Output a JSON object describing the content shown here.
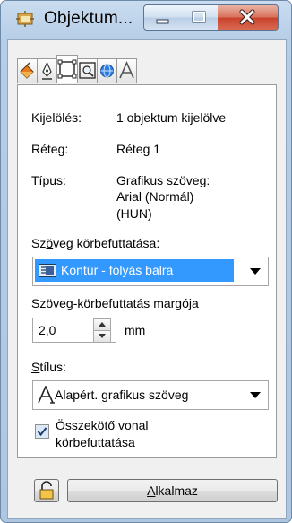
{
  "window": {
    "title": "Objektum...",
    "minimize_icon": "minimize-icon",
    "maximize_icon": "maximize-icon",
    "close_icon": "close-icon",
    "app_icon": "object-properties-icon"
  },
  "tabs": [
    {
      "name": "fill-tab",
      "icon": "fill-bucket-icon"
    },
    {
      "name": "outline-tab",
      "icon": "pen-nib-icon"
    },
    {
      "name": "general-tab",
      "icon": "selection-frame-icon",
      "active": true
    },
    {
      "name": "detail-tab",
      "icon": "zoom-frame-icon"
    },
    {
      "name": "internet-tab",
      "icon": "globe-icon"
    },
    {
      "name": "text-tab",
      "icon": "text-a-icon"
    }
  ],
  "info": {
    "selection_label": "Kijelölés:",
    "selection_value": "1 objektum kijelölve",
    "layer_label": "Réteg:",
    "layer_value": "Réteg 1",
    "type_label": "Típus:",
    "type_value_line1": "Grafikus szöveg:",
    "type_value_line2": "Arial (Normál)",
    "type_value_line3": "(HUN)"
  },
  "wrap": {
    "label_pre": "Sz",
    "label_accel": "ö",
    "label_post": "veg körbefuttatása:",
    "selected": "Kontúr - folyás balra",
    "selected_icon": "contour-wrap-icon"
  },
  "margin": {
    "label_pre": "Szöv",
    "label_accel": "e",
    "label_post": "g-körbefuttatás margója",
    "value": "2,0",
    "unit": "mm",
    "spin_up_icon": "spin-up-icon",
    "spin_down_icon": "spin-down-icon"
  },
  "style": {
    "label_accel": "S",
    "label_post": "tílus:",
    "selected": "Alapért. grafikus szöveg",
    "selected_icon": "text-style-a-icon"
  },
  "connector": {
    "checked": true,
    "label_line1_pre": "Összekötő ",
    "label_line1_accel": "v",
    "label_line1_post": "onal",
    "label_line2": "körbefuttatása"
  },
  "footer": {
    "lock_icon": "lock-icon",
    "apply_accel": "A",
    "apply_post": "lkalmaz"
  },
  "colors": {
    "selection": "#3399ff",
    "close_button": "#c8412a",
    "titlebar": "#b6cde6"
  }
}
